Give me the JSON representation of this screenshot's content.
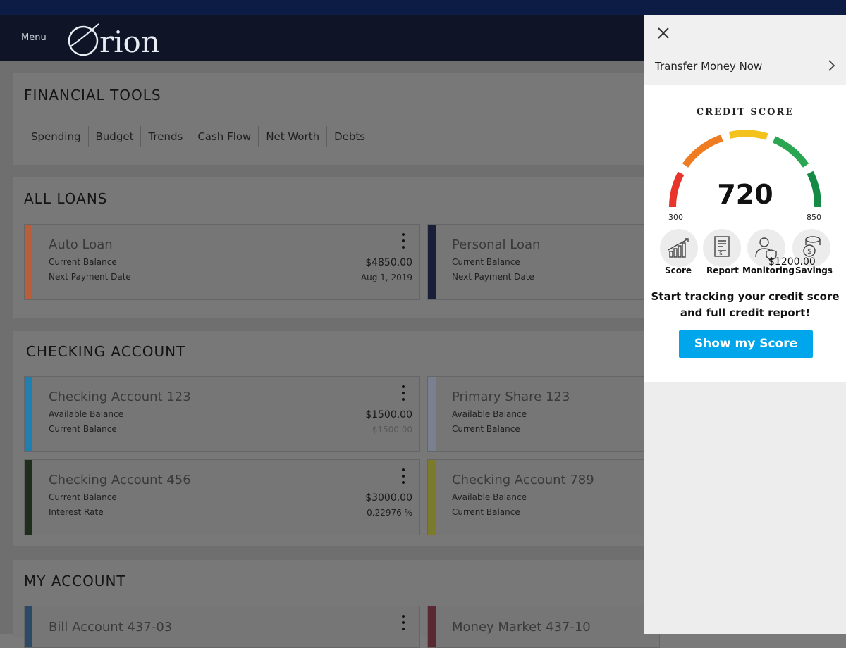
{
  "app": {
    "menu_label": "Menu",
    "logo_text": "Orion"
  },
  "colors": {
    "header_bg": "#0f1527",
    "status_bar": "#0d1c45",
    "accent_button": "#00a6ec",
    "gauge_red": "#e8342a",
    "gauge_orange": "#f07c22",
    "gauge_yellow": "#f4c21c",
    "gauge_green": "#2aa653",
    "gauge_dark_green": "#148a45"
  },
  "financial_tools": {
    "title": "FINANCIAL TOOLS",
    "tabs": [
      "Spending",
      "Budget",
      "Trends",
      "Cash Flow",
      "Net Worth",
      "Debts"
    ]
  },
  "loans": {
    "title": "ALL LOANS",
    "items": [
      {
        "name": "Auto Loan",
        "label1": "Current Balance",
        "label2": "Next Payment Date",
        "value1": "$4850.00",
        "value2": "Aug 1, 2019",
        "color": "#b85e3a"
      },
      {
        "name": "Personal Loan",
        "label1": "Current Balance",
        "label2": "Next Payment Date",
        "value1": "",
        "value2": "",
        "color": "#1a1f38"
      }
    ]
  },
  "checking": {
    "title": "CHECKING ACCOUNT",
    "items": [
      {
        "name": "Checking Account 123",
        "label1": "Available Balance",
        "label2": "Current Balance",
        "value1": "$1500.00",
        "value2": "$1500.00",
        "color": "#1f7fb0"
      },
      {
        "name": "Primary Share 123",
        "label1": "Available Balance",
        "label2": "Current Balance",
        "value1": "",
        "value2": "",
        "color": "#7a8090"
      },
      {
        "name": "Checking Account 456",
        "label1": "Current Balance",
        "label2": "Interest Rate",
        "value1": "$3000.00",
        "value2": "0.22976 %",
        "color": "#1f2d1c"
      },
      {
        "name": "Checking Account 789",
        "label1": "Available Balance",
        "label2": "Current Balance",
        "value1": "",
        "value2": "",
        "color": "#7c7b2c"
      }
    ]
  },
  "my_account": {
    "title": "MY ACCOUNT",
    "items": [
      {
        "name": "Bill Account 437-03",
        "color": "#2c4a66"
      },
      {
        "name": "Money Market 437-10",
        "color": "#5a2830"
      }
    ]
  },
  "panel": {
    "transfer_label": "Transfer Money Now",
    "credit_title": "CREDIT SCORE",
    "score": "720",
    "score_min": "300",
    "score_max": "850",
    "features": [
      {
        "label": "Score",
        "icon": "chart-growth-icon"
      },
      {
        "label": "Report",
        "icon": "document-icon"
      },
      {
        "label": "Monitoring",
        "icon": "user-shield-icon"
      },
      {
        "label": "Savings",
        "icon": "money-coins-icon"
      }
    ],
    "savings_amount": "$1200.00",
    "tagline_line1": "Start tracking your credit score",
    "tagline_line2": "and full credit report!",
    "button_label": "Show my Score"
  }
}
